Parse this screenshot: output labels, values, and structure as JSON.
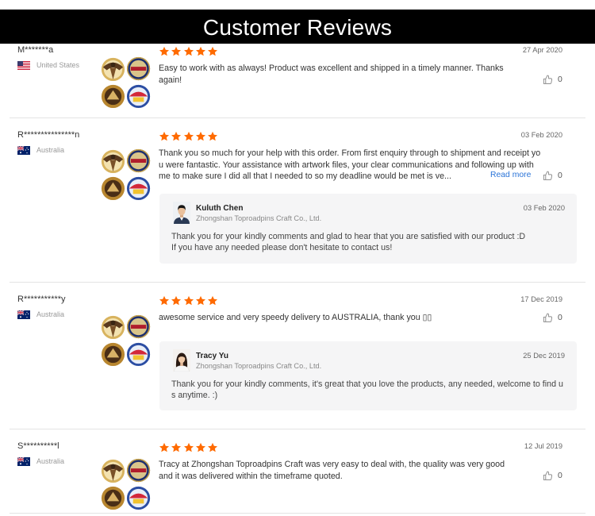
{
  "header": {
    "title": "Customer Reviews"
  },
  "colors": {
    "star": "#ff6a00",
    "link": "#2a74d8",
    "reply_background": "#f5f5f6",
    "divider": "#e4e4e4"
  },
  "icons": {
    "rating": "star-icon",
    "like": "thumbs-up-icon",
    "product": "product-thumbnail"
  },
  "reviews": [
    {
      "reviewer": "M*******a",
      "country": "United States",
      "flag_icon": "us-flag-icon",
      "rating": 5,
      "date": "27 Apr 2020",
      "text_lines": [
        "Easy to work with as always! Product was excellent and shipped in a timely manner. Thanks",
        "again!"
      ],
      "likes": "0"
    },
    {
      "reviewer": "R***************n",
      "country": "Australia",
      "flag_icon": "australia-flag-icon",
      "rating": 5,
      "date": "03 Feb 2020",
      "text_lines": [
        "Thank you so much for your help with this order. From first enquiry through to shipment and receipt yo",
        "u were fantastic. Your assistance with artwork files, your clear communications and following up with",
        "me to make sure I did all that I needed to so my deadline would be met is ve..."
      ],
      "read_more": "Read more",
      "likes": "0",
      "reply": {
        "author": "Kuluth Chen",
        "company": "Zhongshan Toproadpins Craft Co., Ltd.",
        "date": "03 Feb 2020",
        "text_lines": [
          "Thank you for your kindly comments and glad to hear that you are satisfied with our product :D",
          "If you have any needed please don't hesitate to contact us!"
        ]
      }
    },
    {
      "reviewer": "R***********y",
      "country": "Australia",
      "flag_icon": "australia-flag-icon",
      "rating": 5,
      "date": "17 Dec 2019",
      "text_lines": [
        "awesome service and very speedy delivery to AUSTRALIA, thank you ▯▯"
      ],
      "likes": "0",
      "reply": {
        "author": "Tracy Yu",
        "company": "Zhongshan Toproadpins Craft Co., Ltd.",
        "date": "25 Dec 2019",
        "text_lines": [
          "Thank you for your kindly comments, it's great that you love the products, any needed, welcome to find u",
          "s anytime. :)"
        ]
      }
    },
    {
      "reviewer": "S**********l",
      "country": "Australia",
      "flag_icon": "australia-flag-icon",
      "rating": 5,
      "date": "12 Jul 2019",
      "text_lines": [
        "Tracy at Zhongshan Toproadpins Craft was very easy to deal with, the quality was very good",
        "and it was delivered within the timeframe quoted."
      ],
      "likes": "0"
    }
  ]
}
